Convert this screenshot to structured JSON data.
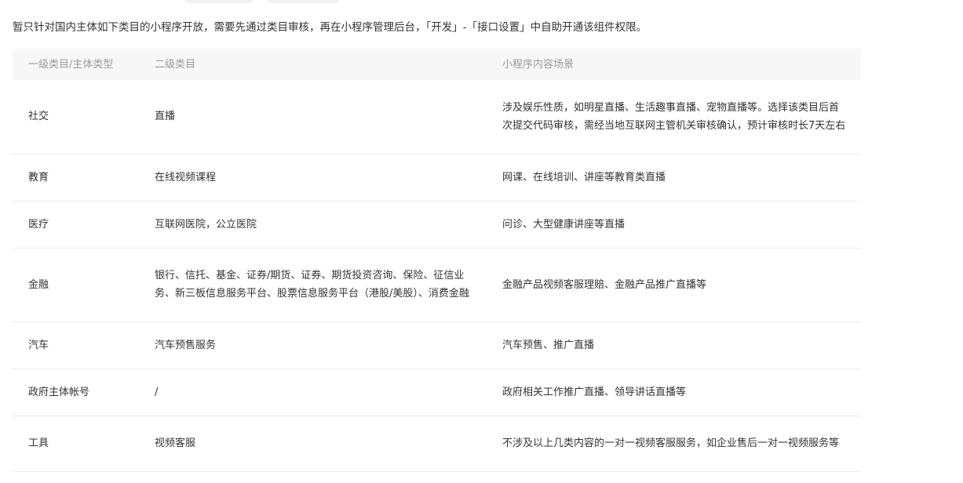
{
  "intro": "暂只针对国内主体如下类目的小程序开放，需要先通过类目审核，再在小程序管理后台，「开发」-「接口设置」中自助开通该组件权限。",
  "table": {
    "headers": [
      "一级类目/主体类型",
      "二级类目",
      "小程序内容场景"
    ],
    "rows": [
      {
        "primary": "社交",
        "secondary": "直播",
        "scene": "涉及娱乐性质，如明星直播、生活趣事直播、宠物直播等。选择该类目后首次提交代码审核，需经当地互联网主管机关审核确认，预计审核时长7天左右"
      },
      {
        "primary": "教育",
        "secondary": "在线视频课程",
        "scene": "网课、在线培训、讲座等教育类直播"
      },
      {
        "primary": "医疗",
        "secondary": "互联网医院，公立医院",
        "scene": "问诊、大型健康讲座等直播"
      },
      {
        "primary": "金融",
        "secondary": "银行、信托、基金、证券/期货、证券、期货投资咨询、保险、征信业务、新三板信息服务平台、股票信息服务平台（港股/美股）、消费金融",
        "scene": "金融产品视频客服理赔、金融产品推广直播等"
      },
      {
        "primary": "汽车",
        "secondary": "汽车预售服务",
        "scene": "汽车预售、推广直播"
      },
      {
        "primary": "政府主体帐号",
        "secondary": "/",
        "scene": "政府相关工作推广直播、领导讲话直播等"
      },
      {
        "primary": "工具",
        "secondary": "视频客服",
        "scene": "不涉及以上几类内容的一对一视频客服服务，如企业售后一对一视频服务等"
      }
    ]
  }
}
